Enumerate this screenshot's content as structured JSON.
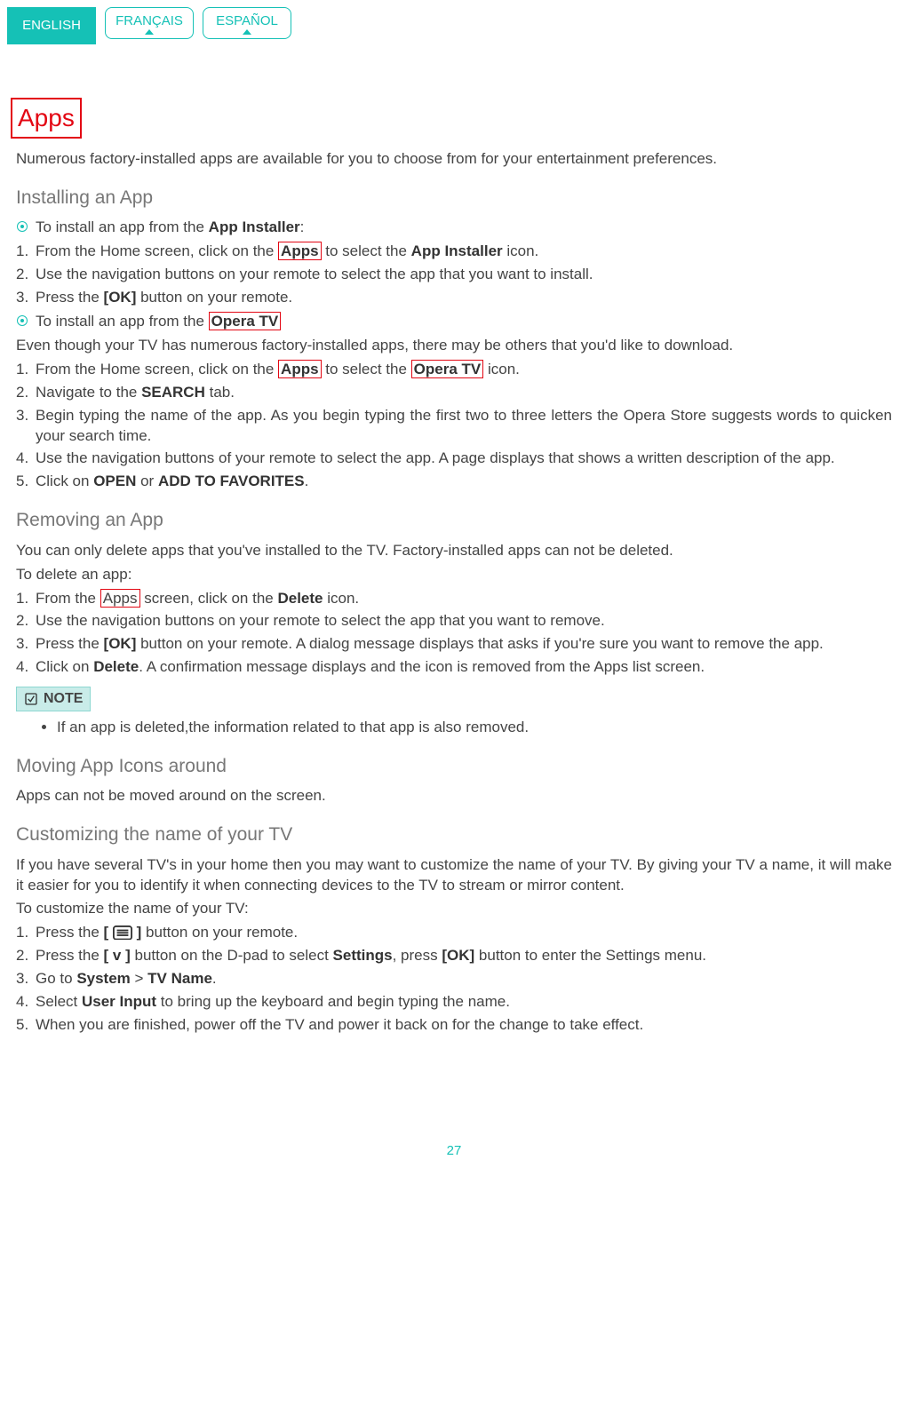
{
  "langs": [
    {
      "label": "ENGLISH",
      "active": true
    },
    {
      "label": "FRANÇAIS",
      "active": false
    },
    {
      "label": "ESPAÑOL",
      "active": false
    }
  ],
  "title": "Apps",
  "intro": "Numerous factory-installed apps are available for you to choose from for your entertainment preferences.",
  "page_number": "27",
  "install": {
    "heading": "Installing an App",
    "lead1_pre": "To install an app from the ",
    "lead1_bold": "App Installer",
    "lead1_post": ":",
    "steps1": [
      {
        "pre": "From the Home screen, click on the ",
        "hi": "Apps",
        "mid": " to select the ",
        "bold": "App Installer",
        "post": " icon."
      },
      {
        "text": "Use the navigation buttons on your remote to select the app that you want to install."
      },
      {
        "pre": "Press the ",
        "bold": "[OK]",
        "post": " button on your remote."
      }
    ],
    "lead2_pre": "To install an app from the ",
    "lead2_hi_bold": "Opera TV",
    "lead2_post": ":",
    "even_text": "Even though your TV has numerous factory-installed apps, there may be others that you'd like to download.",
    "steps2": [
      {
        "pre": "From the Home screen, click on the ",
        "hi1": "Apps",
        "mid": " to select the ",
        "hi2_bold": "Opera TV",
        "post": " icon."
      },
      {
        "pre": "Navigate to the ",
        "bold": "SEARCH",
        "post": " tab."
      },
      {
        "text": "Begin typing the name of the app. As you begin typing the first two to three letters the Opera Store suggests words to quicken your search time."
      },
      {
        "text": "Use the navigation buttons of your remote to select the app. A page displays that shows a written description of the app."
      },
      {
        "pre": "Click on ",
        "bold1": "OPEN",
        "mid": " or ",
        "bold2": "ADD TO FAVORITES",
        "post": "."
      }
    ]
  },
  "remove": {
    "heading": "Removing an App",
    "lead": "You can only delete apps that you've installed to the TV. Factory-installed apps can not be deleted.",
    "sublead": "To delete an app:",
    "steps": [
      {
        "pre": "From the ",
        "hi": "Apps",
        "mid": " screen, click on the ",
        "bold": "Delete",
        "post": " icon."
      },
      {
        "text": "Use the navigation buttons on your remote to select the app that you want to remove."
      },
      {
        "pre": "Press the ",
        "bold": "[OK]",
        "post": " button on your remote. A dialog message displays that asks if you're sure you want to remove the app."
      },
      {
        "pre": "Click on ",
        "bold": "Delete",
        "post": ". A confirmation message displays and the icon is removed from the Apps list screen."
      }
    ],
    "note_label": "NOTE",
    "note_item": "If an app is deleted,the information related to that app is also removed."
  },
  "moving": {
    "heading": "Moving App Icons around",
    "text": "Apps can not be moved around on the screen."
  },
  "custom": {
    "heading": "Customizing the name of your TV",
    "lead": "If you have several TV's in your home then you may want to customize the name of your TV. By giving your TV a name, it will make it easier for you to identify it when connecting devices to the TV to stream or mirror content.",
    "sublead": "To customize the name of your TV:",
    "steps": [
      {
        "pre": "Press the ",
        "bold1": "[ ",
        "icon": true,
        "bold2": " ]",
        "post": " button on your remote."
      },
      {
        "pre": "Press the ",
        "bold1": "[ v ]",
        "mid1": " button on the D-pad to select ",
        "bold2": "Settings",
        "mid2": ", press ",
        "bold3": "[OK]",
        "post": " button to enter the Settings menu."
      },
      {
        "pre": "Go to ",
        "bold1": "System",
        "mid": " > ",
        "bold2": "TV Name",
        "post": "."
      },
      {
        "pre": "Select ",
        "bold": "User Input",
        "post": " to bring up the keyboard and begin typing the name."
      },
      {
        "text": "When you are finished, power off the TV and power it back on for the change to take effect."
      }
    ]
  }
}
